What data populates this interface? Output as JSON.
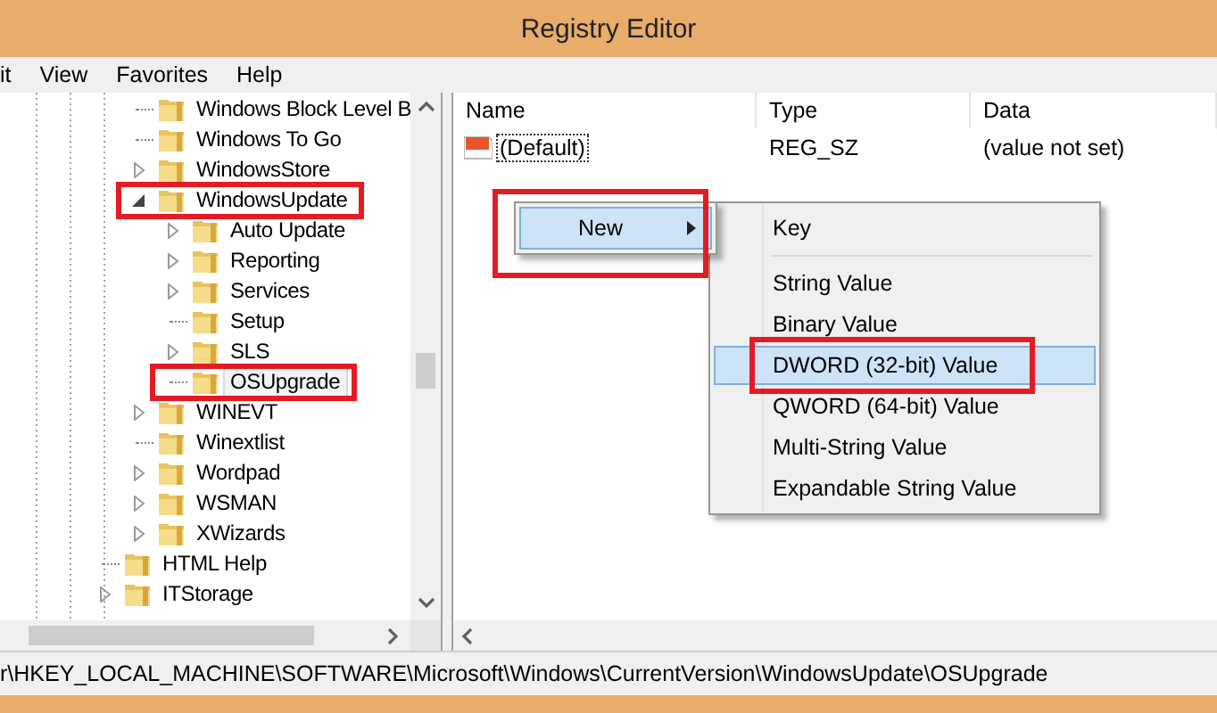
{
  "window": {
    "title": "Registry Editor"
  },
  "menu": [
    {
      "label": "it"
    },
    {
      "label": "View"
    },
    {
      "label": "Favorites"
    },
    {
      "label": "Help"
    }
  ],
  "tree": {
    "items": [
      {
        "children": [
          {
            "label": "Windows Block Level B",
            "expandable": false,
            "expanded": false,
            "selected": false,
            "annotated": false
          },
          {
            "label": "Windows To Go",
            "expandable": false,
            "expanded": false,
            "selected": false,
            "annotated": false
          },
          {
            "label": "WindowsStore",
            "expandable": true,
            "expanded": false,
            "selected": false,
            "annotated": false
          },
          {
            "label": "WindowsUpdate",
            "expandable": true,
            "expanded": true,
            "selected": false,
            "annotated": true,
            "children": [
              {
                "label": "Auto Update",
                "expandable": true,
                "expanded": false,
                "selected": false,
                "annotated": false
              },
              {
                "label": "Reporting",
                "expandable": true,
                "expanded": false,
                "selected": false,
                "annotated": false
              },
              {
                "label": "Services",
                "expandable": true,
                "expanded": false,
                "selected": false,
                "annotated": false
              },
              {
                "label": "Setup",
                "expandable": false,
                "expanded": false,
                "selected": false,
                "annotated": false
              },
              {
                "label": "SLS",
                "expandable": true,
                "expanded": false,
                "selected": false,
                "annotated": false
              },
              {
                "label": "OSUpgrade",
                "expandable": false,
                "expanded": false,
                "selected": true,
                "annotated": true
              }
            ]
          },
          {
            "label": "WINEVT",
            "expandable": true,
            "expanded": false,
            "selected": false,
            "annotated": false
          },
          {
            "label": "Winextlist",
            "expandable": false,
            "expanded": false,
            "selected": false,
            "annotated": false
          },
          {
            "label": "Wordpad",
            "expandable": true,
            "expanded": false,
            "selected": false,
            "annotated": false
          },
          {
            "label": "WSMAN",
            "expandable": true,
            "expanded": false,
            "selected": false,
            "annotated": false
          },
          {
            "label": "XWizards",
            "expandable": true,
            "expanded": false,
            "selected": false,
            "annotated": false
          }
        ]
      },
      {
        "label": "HTML Help",
        "expandable": false,
        "expanded": false,
        "selected": false,
        "annotated": false
      },
      {
        "label": "ITStorage",
        "expandable": true,
        "expanded": false,
        "selected": false,
        "annotated": false
      }
    ]
  },
  "values": {
    "columns": [
      "Name",
      "Type",
      "Data"
    ],
    "rows": [
      {
        "name": "(Default)",
        "type": "REG_SZ",
        "data": "(value not set)"
      }
    ]
  },
  "context_menu": {
    "items": [
      {
        "label": "New",
        "selected": true,
        "annotated": true
      }
    ],
    "submenu": [
      {
        "kind": "item",
        "label": "Key",
        "selected": false,
        "annotated": false
      },
      {
        "kind": "separator"
      },
      {
        "kind": "item",
        "label": "String Value",
        "selected": false,
        "annotated": false
      },
      {
        "kind": "item",
        "label": "Binary Value",
        "selected": false,
        "annotated": false
      },
      {
        "kind": "item",
        "label": "DWORD (32-bit) Value",
        "selected": true,
        "annotated": true
      },
      {
        "kind": "item",
        "label": "QWORD (64-bit) Value",
        "selected": false,
        "annotated": false
      },
      {
        "kind": "item",
        "label": "Multi-String Value",
        "selected": false,
        "annotated": false
      },
      {
        "kind": "item",
        "label": "Expandable String Value",
        "selected": false,
        "annotated": false
      }
    ]
  },
  "status_bar": {
    "path": "r\\HKEY_LOCAL_MACHINE\\SOFTWARE\\Microsoft\\Windows\\CurrentVersion\\WindowsUpdate\\OSUpgrade"
  }
}
